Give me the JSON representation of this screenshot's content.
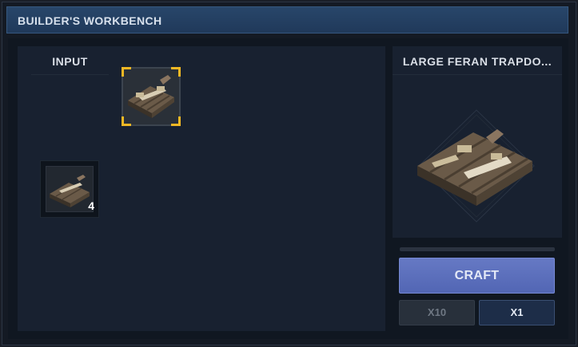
{
  "window": {
    "title": "BUILDER'S WORKBENCH"
  },
  "input_panel": {
    "header": "INPUT",
    "selected_slot": {
      "item": "trapdoor-icon",
      "selected": true
    },
    "item_slot": {
      "item": "trapdoor-icon",
      "count": "4"
    }
  },
  "recipe_panel": {
    "title": "LARGE FERAN TRAPDO...",
    "preview_item": "trapdoor-icon",
    "craft_label": "CRAFT",
    "quantity_options": [
      {
        "label": "X10",
        "enabled": false
      },
      {
        "label": "X1",
        "enabled": true,
        "active": true
      }
    ]
  },
  "colors": {
    "accent": "#5a6ebc",
    "selection": "#f2b824",
    "titlebar": "#254265"
  }
}
